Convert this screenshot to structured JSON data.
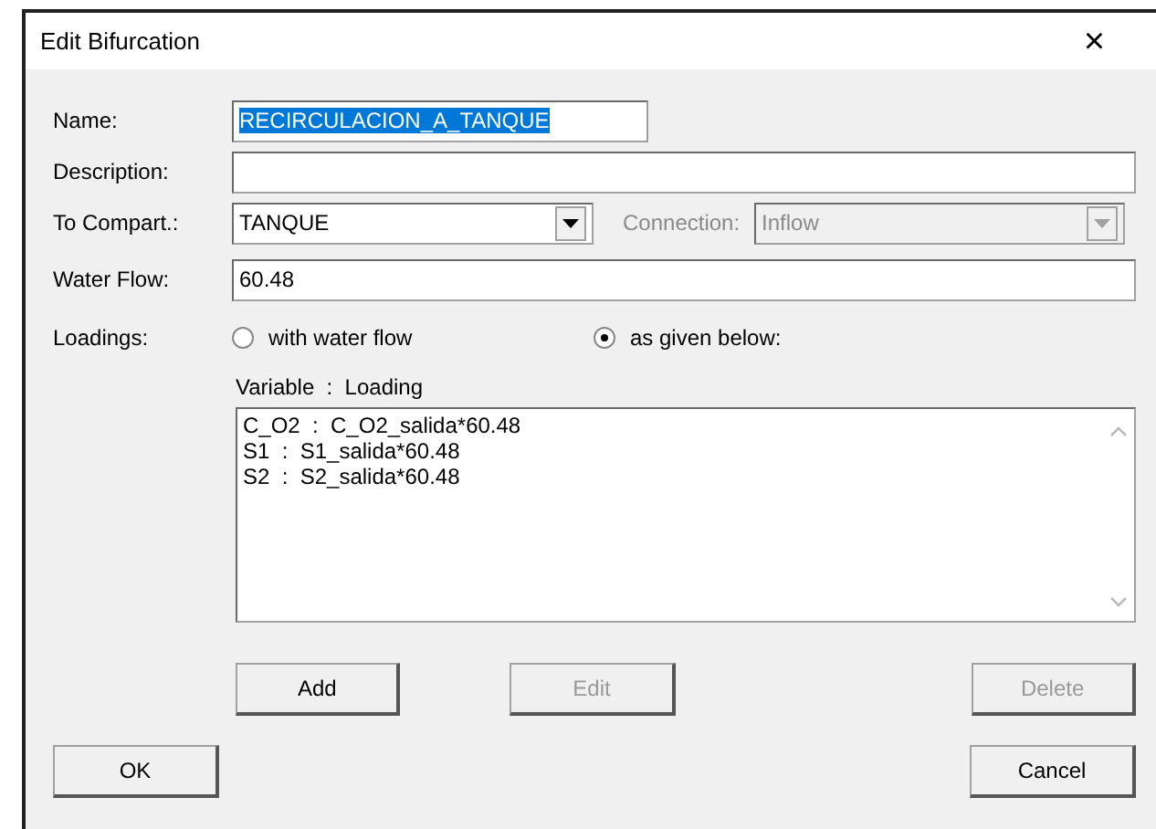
{
  "window": {
    "title": "Edit Bifurcation",
    "close": "×"
  },
  "name": {
    "label": "Name:",
    "value": "RECIRCULACION_A_TANQUE",
    "highlighted": true
  },
  "description": {
    "label": "Description:"
  },
  "compartment": {
    "label": "To Compart.:",
    "value": "TANQUE",
    "disabled": false
  },
  "connection": {
    "label": "Connection:",
    "value": "Inflow",
    "disabled": true
  },
  "water_flow": {
    "label": "Water Flow:",
    "value": "60.48"
  },
  "loadings": {
    "label": "Loadings:",
    "options": [
      {
        "label": "with water flow",
        "selected": false
      },
      {
        "label": "as given below:",
        "selected": true
      }
    ],
    "list_header": "Variable  :  Loading",
    "items": [
      "C_O2  :  C_O2_salida*60.48",
      "S1  :  S1_salida*60.48",
      "S2  :  S2_salida*60.48"
    ]
  },
  "list_buttons": [
    {
      "label": "Add",
      "disabled": false
    },
    {
      "label": "Edit",
      "disabled": true
    },
    {
      "label": "Delete",
      "disabled": true
    }
  ],
  "dialog_buttons": [
    {
      "label": "OK",
      "disabled": false
    },
    {
      "label": "Cancel",
      "disabled": false
    }
  ]
}
